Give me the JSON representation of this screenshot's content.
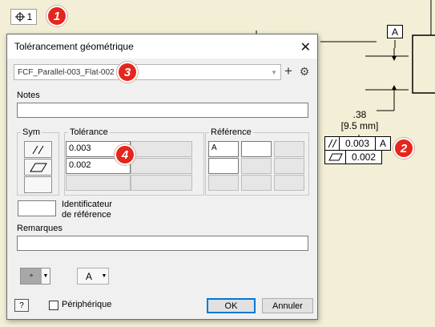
{
  "top_chip": {
    "label": "1"
  },
  "badges": [
    "1",
    "2",
    "3",
    "4"
  ],
  "drawing": {
    "datum_letter": "A",
    "dimension_value": ".38",
    "dimension_metric": "[9.5 mm]",
    "fcf_row1": {
      "tolerance": "0.003",
      "datum": "A"
    },
    "fcf_row2": {
      "tolerance": "0.002"
    }
  },
  "dialog": {
    "title": "Tolérancement géométrique",
    "style_combo": "FCF_Parallel-003_Flat-002",
    "notes_label": "Notes",
    "notes_value": "",
    "sym_label": "Sym",
    "tolerance_label": "Tolérance",
    "tolerance_values": [
      "0.003",
      "0.002"
    ],
    "reference_label": "Référence",
    "reference_values": [
      "A"
    ],
    "identifier_label_line1": "Identificateur",
    "identifier_label_line2": "de référence",
    "remarks_label": "Remarques",
    "remarks_value": "",
    "dot_button": "∘",
    "letter_button": "A",
    "peripheral_label": "Périphérique",
    "peripheral_checked": false,
    "ok_label": "OK",
    "cancel_label": "Annuler"
  },
  "colors": {
    "badge": "#e4261c",
    "background": "#f3efd6",
    "accent": "#0078d7"
  }
}
